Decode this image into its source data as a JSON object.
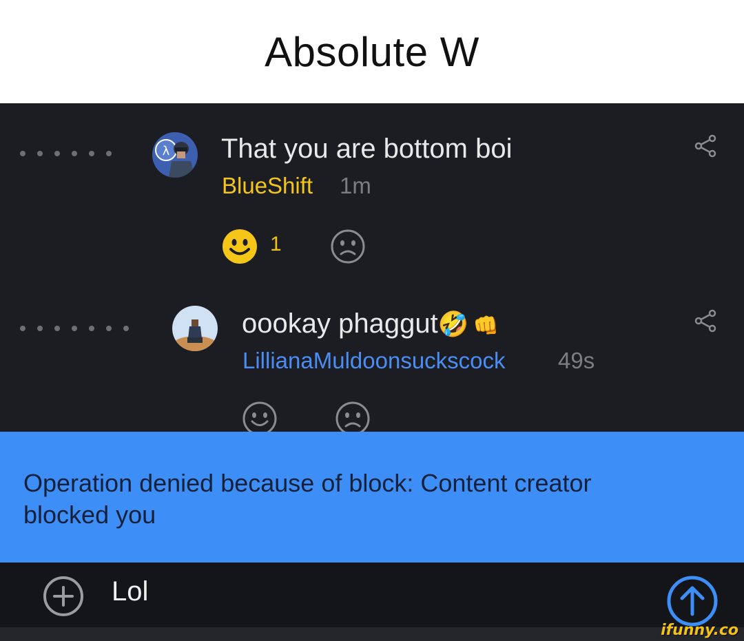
{
  "caption": {
    "text": "Absolute W"
  },
  "comments": [
    {
      "text": "That you are bottom boi",
      "username": "BlueShift",
      "username_color": "#f5c518",
      "timestamp": "1m",
      "likes": "1",
      "liked": true,
      "avatar_icon": "soldier-avatar-icon"
    },
    {
      "text": "oookay phaggut",
      "emojis": [
        "🤣",
        "👊"
      ],
      "username": "LillianaMuldoonsuckscock",
      "username_color": "#4a8ef5",
      "timestamp": "49s",
      "likes": "",
      "liked": false,
      "avatar_icon": "desert-person-avatar-icon"
    }
  ],
  "toast": {
    "message": "Operation denied because of block: Content creator blocked you"
  },
  "input": {
    "value": "Lol"
  },
  "watermark": {
    "text": "ifunny.co"
  },
  "colors": {
    "background": "#1c1d22",
    "toast": "#3d8ef6",
    "send": "#3d8ef6",
    "like": "#f2c214"
  }
}
